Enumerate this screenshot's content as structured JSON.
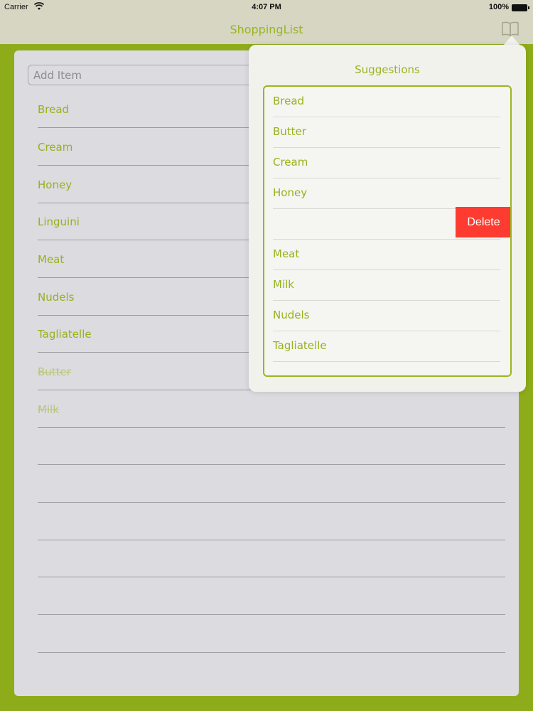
{
  "status_bar": {
    "carrier": "Carrier",
    "time": "4:07 PM",
    "battery": "100%"
  },
  "nav": {
    "title": "ShoppingList",
    "right_icon": "book-icon"
  },
  "add_item": {
    "placeholder": "Add Item"
  },
  "shopping_list": {
    "items": [
      {
        "label": "Bread",
        "checked": false
      },
      {
        "label": "Cream",
        "checked": false
      },
      {
        "label": "Honey",
        "checked": false
      },
      {
        "label": "Linguini",
        "checked": false
      },
      {
        "label": "Meat",
        "checked": false
      },
      {
        "label": "Nudels",
        "checked": false
      },
      {
        "label": "Tagliatelle",
        "checked": false
      },
      {
        "label": "Butter",
        "checked": true
      },
      {
        "label": "Milk",
        "checked": true
      }
    ]
  },
  "suggestions": {
    "title": "Suggestions",
    "items": [
      "Bread",
      "Butter",
      "Cream",
      "Honey",
      "",
      "Meat",
      "Milk",
      "Nudels",
      "Tagliatelle"
    ],
    "delete_label": "Delete"
  },
  "colors": {
    "accent_green": "#9bb51f",
    "background_green": "#8eac1a",
    "delete_red": "#fe3b30"
  }
}
